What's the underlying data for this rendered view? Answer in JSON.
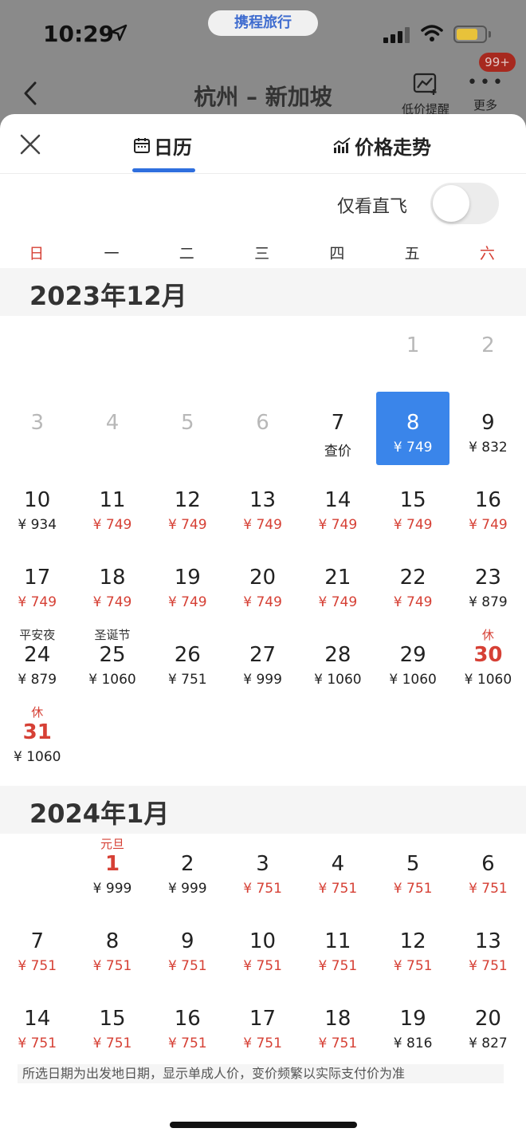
{
  "status_bar": {
    "time": "10:29",
    "brand": "携程旅行"
  },
  "header": {
    "title": "杭州 – 新加坡",
    "price_alert": "低价提醒",
    "more": "更多",
    "badge": "99+"
  },
  "tabs": [
    {
      "label": "日历"
    },
    {
      "label": "价格走势"
    }
  ],
  "filter": {
    "direct_only_label": "仅看直飞",
    "direct_only_on": false
  },
  "weekdays": [
    "日",
    "一",
    "二",
    "三",
    "四",
    "五",
    "六"
  ],
  "months": [
    {
      "title": "2023年12月",
      "days": [
        {
          "d": "1",
          "price": "",
          "grey": true
        },
        {
          "d": "2",
          "price": "",
          "grey": true
        },
        {
          "d": "3",
          "price": "",
          "grey": true
        },
        {
          "d": "4",
          "price": "",
          "grey": true
        },
        {
          "d": "5",
          "price": "",
          "grey": true
        },
        {
          "d": "6",
          "price": "",
          "grey": true
        },
        {
          "d": "7",
          "price": "查价"
        },
        {
          "d": "8",
          "price": "¥ 749",
          "selected": true
        },
        {
          "d": "9",
          "price": "¥ 832"
        },
        {
          "d": "10",
          "price": "¥ 934"
        },
        {
          "d": "11",
          "price": "¥ 749",
          "low": true
        },
        {
          "d": "12",
          "price": "¥ 749",
          "low": true
        },
        {
          "d": "13",
          "price": "¥ 749",
          "low": true
        },
        {
          "d": "14",
          "price": "¥ 749",
          "low": true
        },
        {
          "d": "15",
          "price": "¥ 749",
          "low": true
        },
        {
          "d": "16",
          "price": "¥ 749",
          "low": true
        },
        {
          "d": "17",
          "price": "¥ 749",
          "low": true
        },
        {
          "d": "18",
          "price": "¥ 749",
          "low": true
        },
        {
          "d": "19",
          "price": "¥ 749",
          "low": true
        },
        {
          "d": "20",
          "price": "¥ 749",
          "low": true
        },
        {
          "d": "21",
          "price": "¥ 749",
          "low": true
        },
        {
          "d": "22",
          "price": "¥ 749",
          "low": true
        },
        {
          "d": "23",
          "price": "¥ 879"
        },
        {
          "d": "24",
          "price": "¥ 879",
          "note": "平安夜"
        },
        {
          "d": "25",
          "price": "¥ 1060",
          "note": "圣诞节"
        },
        {
          "d": "26",
          "price": "¥ 751"
        },
        {
          "d": "27",
          "price": "¥ 999"
        },
        {
          "d": "28",
          "price": "¥ 1060"
        },
        {
          "d": "29",
          "price": "¥ 1060"
        },
        {
          "d": "30",
          "price": "¥ 1060",
          "note": "休",
          "holiday": true
        },
        {
          "d": "31",
          "price": "¥ 1060",
          "note": "休",
          "holiday": true
        }
      ]
    },
    {
      "title": "2024年1月",
      "days": [
        {
          "d": "1",
          "price": "¥ 999",
          "note": "元旦",
          "holiday": true
        },
        {
          "d": "2",
          "price": "¥ 999"
        },
        {
          "d": "3",
          "price": "¥ 751",
          "low": true
        },
        {
          "d": "4",
          "price": "¥ 751",
          "low": true
        },
        {
          "d": "5",
          "price": "¥ 751",
          "low": true
        },
        {
          "d": "6",
          "price": "¥ 751",
          "low": true
        },
        {
          "d": "7",
          "price": "¥ 751",
          "low": true
        },
        {
          "d": "8",
          "price": "¥ 751",
          "low": true
        },
        {
          "d": "9",
          "price": "¥ 751",
          "low": true
        },
        {
          "d": "10",
          "price": "¥ 751",
          "low": true
        },
        {
          "d": "11",
          "price": "¥ 751",
          "low": true
        },
        {
          "d": "12",
          "price": "¥ 751",
          "low": true
        },
        {
          "d": "13",
          "price": "¥ 751",
          "low": true
        },
        {
          "d": "14",
          "price": "¥ 751",
          "low": true
        },
        {
          "d": "15",
          "price": "¥ 751",
          "low": true
        },
        {
          "d": "16",
          "price": "¥ 751",
          "low": true
        },
        {
          "d": "17",
          "price": "¥ 751",
          "low": true
        },
        {
          "d": "18",
          "price": "¥ 751",
          "low": true
        },
        {
          "d": "19",
          "price": "¥ 816"
        },
        {
          "d": "20",
          "price": "¥ 827"
        }
      ]
    }
  ],
  "footer_note": "所选日期为出发地日期，显示单成人价，变价频繁以实际支付价为准",
  "colors": {
    "accent": "#3a85ea",
    "low_price": "#d64035",
    "badge": "#a7291f"
  }
}
